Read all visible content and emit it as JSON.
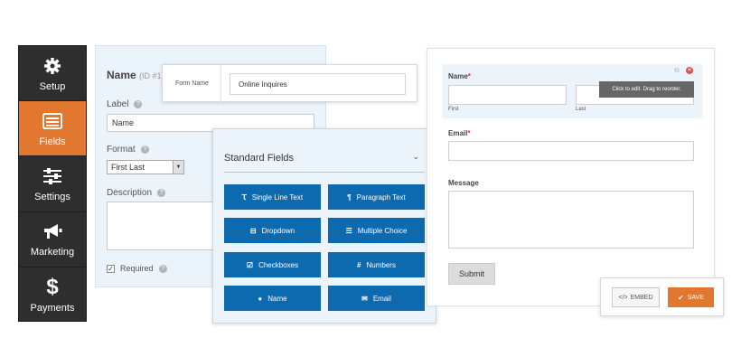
{
  "sidebar": {
    "items": [
      {
        "label": "Setup",
        "icon": "gear-icon"
      },
      {
        "label": "Fields",
        "icon": "fields-list-icon",
        "active": true
      },
      {
        "label": "Settings",
        "icon": "sliders-icon"
      },
      {
        "label": "Marketing",
        "icon": "megaphone-icon"
      },
      {
        "label": "Payments",
        "icon": "dollar-icon"
      }
    ]
  },
  "field_options": {
    "title": "Name",
    "id_text": "(ID #1)",
    "label_caption": "Label",
    "label_value": "Name",
    "format_caption": "Format",
    "format_value": "First Last",
    "description_caption": "Description",
    "required_label": "Required",
    "required_checked": true
  },
  "form_name": {
    "label": "Form Name",
    "value": "Online Inquires"
  },
  "standard_fields": {
    "title": "Standard Fields",
    "buttons": [
      {
        "label": "Single Line Text",
        "icon": "text-icon"
      },
      {
        "label": "Paragraph Text",
        "icon": "paragraph-icon"
      },
      {
        "label": "Dropdown",
        "icon": "dropdown-icon"
      },
      {
        "label": "Multiple Choice",
        "icon": "list-icon"
      },
      {
        "label": "Checkboxes",
        "icon": "checkbox-icon"
      },
      {
        "label": "Numbers",
        "icon": "hash-icon"
      },
      {
        "label": "Name",
        "icon": "user-icon"
      },
      {
        "label": "Email",
        "icon": "envelope-icon"
      }
    ]
  },
  "preview": {
    "name_label": "Name",
    "first_sub": "First",
    "last_sub": "Last",
    "email_label": "Email",
    "message_label": "Message",
    "submit_label": "Submit",
    "tooltip": "Click to edit. Drag to reorder.",
    "required_mark": "*"
  },
  "actions": {
    "embed_label": "EMBED",
    "save_label": "SAVE"
  },
  "colors": {
    "accent_orange": "#e27730",
    "button_blue": "#0e6aae",
    "sidebar_dark": "#2e2e2e",
    "panel_light_blue": "#ebf3fb"
  }
}
